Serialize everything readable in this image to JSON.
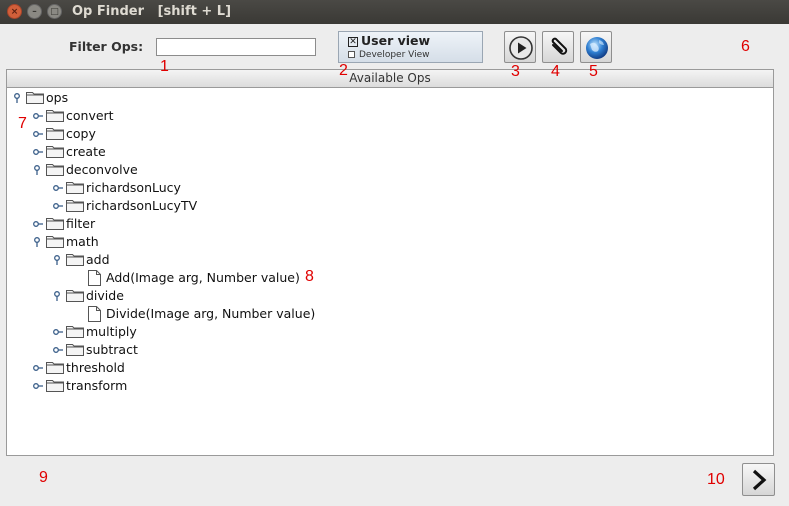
{
  "window": {
    "title": "Op Finder   [shift + L]",
    "controls": [
      "close-icon",
      "minimize-icon",
      "maximize-icon"
    ]
  },
  "toolbar": {
    "filter_label": "Filter Ops:",
    "filter_value": "",
    "user_view_label": "User view",
    "user_view_checked": true,
    "developer_view_label": "Developer View",
    "developer_view_checked": false,
    "buttons": {
      "run": "play-icon",
      "copy": "paperclip-icon",
      "web": "globe-icon"
    }
  },
  "tree": {
    "header": "Available Ops",
    "nodes": [
      {
        "label": "ops",
        "type": "folder",
        "depth": 0,
        "expanded": true
      },
      {
        "label": "convert",
        "type": "folder",
        "depth": 1,
        "expanded": false
      },
      {
        "label": "copy",
        "type": "folder",
        "depth": 1,
        "expanded": false
      },
      {
        "label": "create",
        "type": "folder",
        "depth": 1,
        "expanded": false
      },
      {
        "label": "deconvolve",
        "type": "folder",
        "depth": 1,
        "expanded": true
      },
      {
        "label": "richardsonLucy",
        "type": "folder",
        "depth": 2,
        "expanded": false
      },
      {
        "label": "richardsonLucyTV",
        "type": "folder",
        "depth": 2,
        "expanded": false
      },
      {
        "label": "filter",
        "type": "folder",
        "depth": 1,
        "expanded": false
      },
      {
        "label": "math",
        "type": "folder",
        "depth": 1,
        "expanded": true
      },
      {
        "label": "add",
        "type": "folder",
        "depth": 2,
        "expanded": true
      },
      {
        "label": "Add(Image arg, Number value)",
        "type": "op",
        "depth": 3
      },
      {
        "label": "divide",
        "type": "folder",
        "depth": 2,
        "expanded": true
      },
      {
        "label": "Divide(Image arg, Number value)",
        "type": "op",
        "depth": 3
      },
      {
        "label": "multiply",
        "type": "folder",
        "depth": 2,
        "expanded": false
      },
      {
        "label": "subtract",
        "type": "folder",
        "depth": 2,
        "expanded": false
      },
      {
        "label": "threshold",
        "type": "folder",
        "depth": 1,
        "expanded": false
      },
      {
        "label": "transform",
        "type": "folder",
        "depth": 1,
        "expanded": false
      }
    ]
  },
  "next_button": "chevron-right-icon",
  "annotations": [
    "1",
    "2",
    "3",
    "4",
    "5",
    "6",
    "7",
    "8",
    "9",
    "10"
  ],
  "colors": {
    "titlebar": "#3c3b37",
    "annotation": "#e00000",
    "background": "#ededed",
    "selection_border": "#9aa6b3"
  }
}
